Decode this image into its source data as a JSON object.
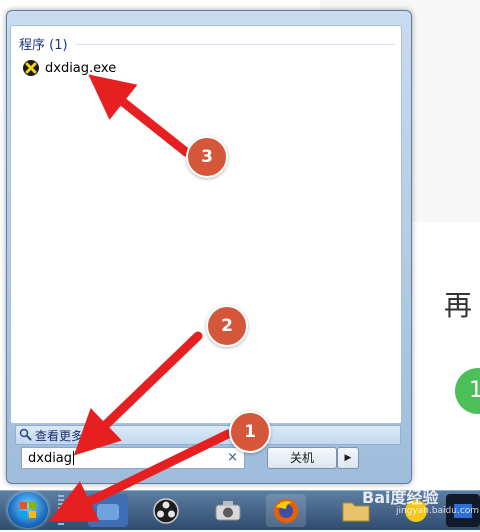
{
  "background_page": {
    "heading_fragment": "再",
    "step_number": "1"
  },
  "start_menu": {
    "section_header": "程序 (1)",
    "program_item": "dxdiag.exe",
    "see_more_text": "查看更多结",
    "search": {
      "value": "dxdiag",
      "clear_symbol": "×"
    },
    "shutdown_label": "关机",
    "shutdown_arrow": "▶"
  },
  "annotations": {
    "badge_1": "1",
    "badge_2": "2",
    "badge_3": "3",
    "arrow_color": "#e62020",
    "badge_color": "#d5573a"
  },
  "watermark": {
    "text": "Bai度经验",
    "sub": "jingyan.baidu.com"
  },
  "taskbar": {
    "icons": [
      "start-orb",
      "app-icon",
      "obs-icon",
      "camera-icon",
      "firefox-icon",
      "folder-icon",
      "emoji-icon",
      "app-icon-right"
    ]
  }
}
